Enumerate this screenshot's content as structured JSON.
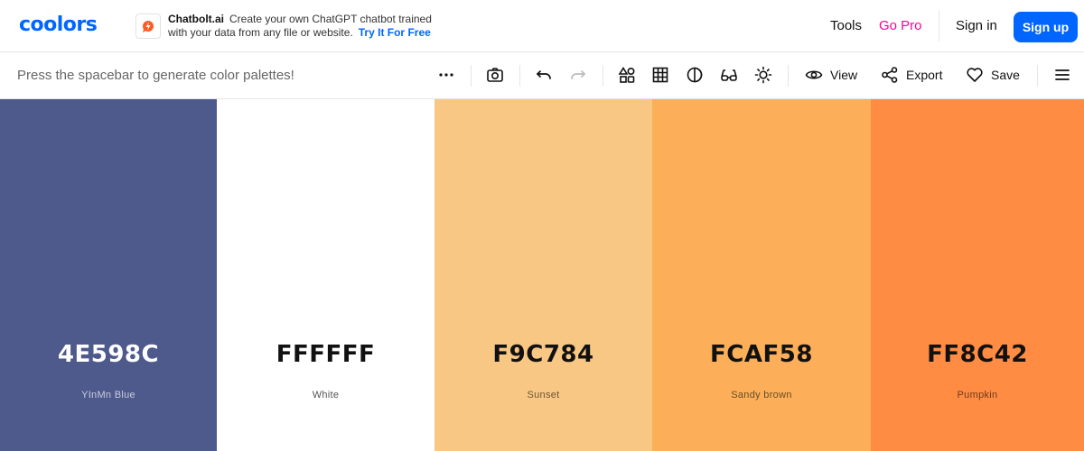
{
  "header": {
    "logo_text": "coolors",
    "brand_color": "#0066ff",
    "ad": {
      "icon": "chatbot-bolt-icon",
      "brand": "Chatbolt.ai",
      "line1": "Create your own ChatGPT chatbot trained",
      "line2": "with your data from any file or website.",
      "cta": "Try It For Free"
    },
    "nav": {
      "tools": "Tools",
      "go_pro": "Go Pro",
      "sign_in": "Sign in",
      "sign_up": "Sign up"
    }
  },
  "toolbar": {
    "hint": "Press the spacebar to generate color palettes!",
    "icons": [
      "more-options-icon",
      "camera-icon",
      "undo-icon",
      "redo-icon",
      "shapes-icon",
      "grid-icon",
      "contrast-icon",
      "glasses-icon",
      "brightness-icon"
    ],
    "view": "View",
    "export": "Export",
    "save": "Save",
    "menu_icon": "hamburger-menu-icon"
  },
  "palette": [
    {
      "hex": "4E598C",
      "name": "YInMn Blue",
      "color": "#4E598C",
      "text_color": "#ffffff",
      "name_color": "#c9cde0"
    },
    {
      "hex": "FFFFFF",
      "name": "White",
      "color": "#FFFFFF",
      "text_color": "#111111",
      "name_color": "#555555"
    },
    {
      "hex": "F9C784",
      "name": "Sunset",
      "color": "#F9C784",
      "text_color": "#111111",
      "name_color": "#6b5637"
    },
    {
      "hex": "FCAF58",
      "name": "Sandy brown",
      "color": "#FCAF58",
      "text_color": "#111111",
      "name_color": "#6b4c25"
    },
    {
      "hex": "FF8C42",
      "name": "Pumpkin",
      "color": "#FF8C42",
      "text_color": "#111111",
      "name_color": "#6e3c1c"
    }
  ]
}
